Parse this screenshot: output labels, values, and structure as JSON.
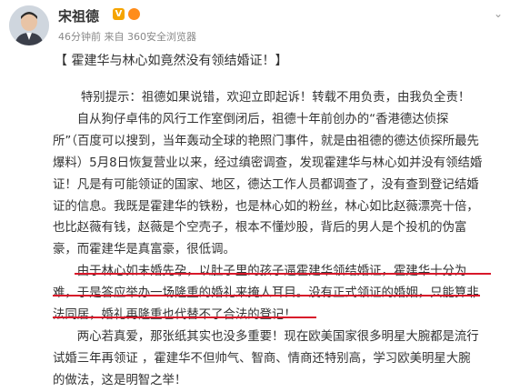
{
  "header": {
    "username": "宋祖德",
    "verified_badge": "V",
    "meta": "46分钟前 来自 360安全浏览器",
    "expand_icon": "chevron-down-icon"
  },
  "post": {
    "headline": "【 霍建华与林心如竟然没有领结婚证！】",
    "lines": [
      "特别提示：祖德如果说错，欢迎立即起诉！转载不用负责，由我负全责！",
      "自从狗仔卓伟的风行工作室倒闭后，祖德十年前创办的“香港德达侦探",
      "所”（百度可以搜到，当年轰动全球的艳照门事件，就是由祖德的德达侦探所最先",
      "爆料）5月8日恢复营业以来，经过缜密调查，发现霍建华与林心如并没有领结婚",
      "证！凡是有可能领证的国家、地区，德达工作人员都调查了，没有查到登记结婚",
      "证的信息。我既是霍建华的铁粉，也是林心如的粉丝，林心如比赵薇漂亮十倍，",
      "也比赵薇有钱，赵薇是个空壳子，根本不懂炒股，背后的男人是个投机的伪富",
      "豪，而霍建华是真富豪，很低调。",
      "由于林心如未婚先孕，以肚子里的孩子逼霍建华领结婚证，霍建华十分为",
      "难，于是答应举办一场隆重的婚礼来掩人耳目。没有正式领证的婚姻，只能算非",
      "法同居，婚礼再隆重也代替不了合法的登记！",
      "两心若真爱，那张纸其实也没多重要！现在欧美国家很多明星大腕都是流行",
      "试婚三年再领证 ，霍建华不但帅气、智商、情商还特别高，学习欧美明星大腕",
      "的做法，这是明智之举！"
    ]
  }
}
